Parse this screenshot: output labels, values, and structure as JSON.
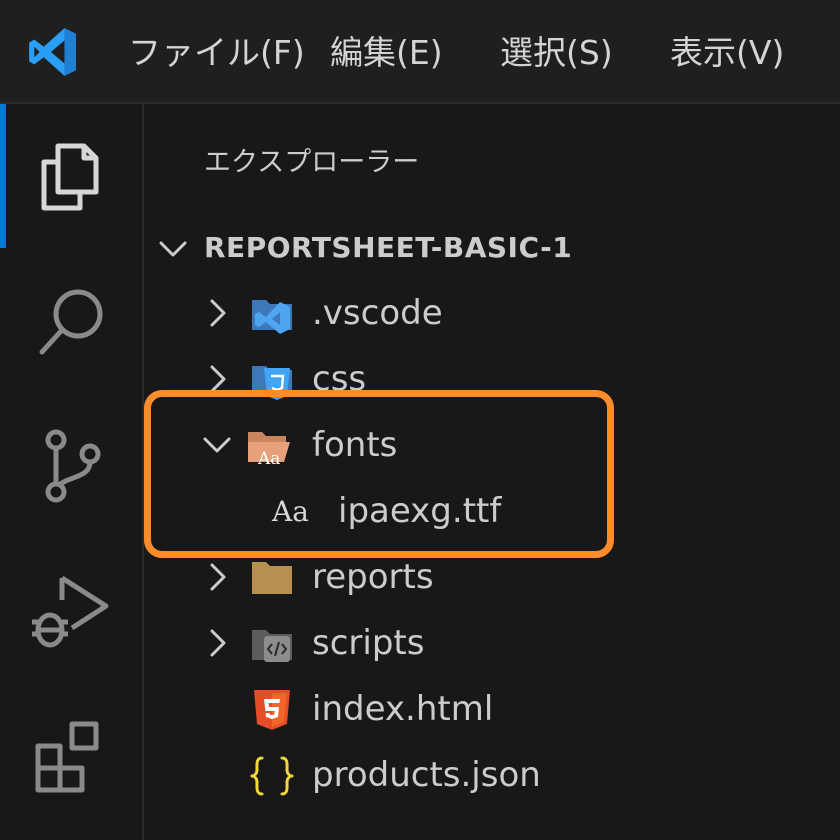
{
  "menu": {
    "items": [
      {
        "label": "ファイル(F)"
      },
      {
        "label": "編集(E)"
      },
      {
        "label": "選択(S)"
      },
      {
        "label": "表示(V)"
      }
    ]
  },
  "explorer": {
    "title": "エクスプローラー",
    "root": "REPORTSHEET-BASIC-1",
    "items": [
      {
        "label": ".vscode",
        "icon": "vscode-folder-icon",
        "expanded": false
      },
      {
        "label": "css",
        "icon": "css-folder-icon",
        "expanded": false
      },
      {
        "label": "fonts",
        "icon": "font-folder-open-icon",
        "expanded": true
      },
      {
        "label": "ipaexg.ttf",
        "icon": "font-file-icon"
      },
      {
        "label": "reports",
        "icon": "folder-icon",
        "expanded": false
      },
      {
        "label": "scripts",
        "icon": "scripts-folder-icon",
        "expanded": false
      },
      {
        "label": "index.html",
        "icon": "html5-icon"
      },
      {
        "label": "products.json",
        "icon": "json-braces-icon"
      }
    ],
    "font_glyph": "Aa"
  },
  "colors": {
    "accent": "#0078d4",
    "highlight": "#ff8c2a",
    "background": "#181818",
    "text": "#cccccc"
  }
}
